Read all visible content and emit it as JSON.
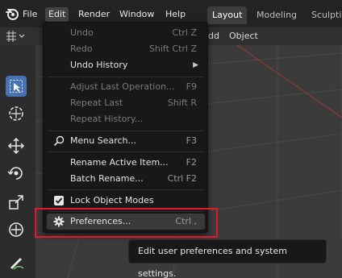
{
  "menubar": {
    "items": [
      "File",
      "Edit",
      "Render",
      "Window",
      "Help"
    ],
    "active": "Edit"
  },
  "workspace_tabs": [
    "Layout",
    "Modeling",
    "Sculpti"
  ],
  "viewport_header": {
    "add_label": "dd",
    "object_label": "Object"
  },
  "edit_menu": {
    "items": [
      {
        "label": "Undo",
        "shortcut": "Ctrl Z",
        "disabled": true
      },
      {
        "label": "Redo",
        "shortcut": "Shift Ctrl Z",
        "disabled": true
      },
      {
        "label": "Undo History",
        "shortcut": "",
        "submenu": true
      },
      {
        "label": "Adjust Last Operation...",
        "shortcut": "F9",
        "disabled": true
      },
      {
        "label": "Repeat Last",
        "shortcut": "Shift R",
        "disabled": true
      },
      {
        "label": "Repeat History...",
        "shortcut": "",
        "disabled": true
      },
      {
        "label": "Menu Search...",
        "shortcut": "F3",
        "icon": "search-icon"
      },
      {
        "label": "Rename Active Item...",
        "shortcut": "F2"
      },
      {
        "label": "Batch Rename...",
        "shortcut": "Ctrl F2"
      },
      {
        "label": "Lock Object Modes",
        "shortcut": "",
        "checkbox": true,
        "checked": true
      },
      {
        "label": "Preferences...",
        "shortcut": "Ctrl ,",
        "icon": "gear-icon",
        "hover": true
      }
    ]
  },
  "tooltip": {
    "text": "Edit user preferences and system settings."
  },
  "colors": {
    "highlight": "#e0182a",
    "select": "#4772b3"
  }
}
